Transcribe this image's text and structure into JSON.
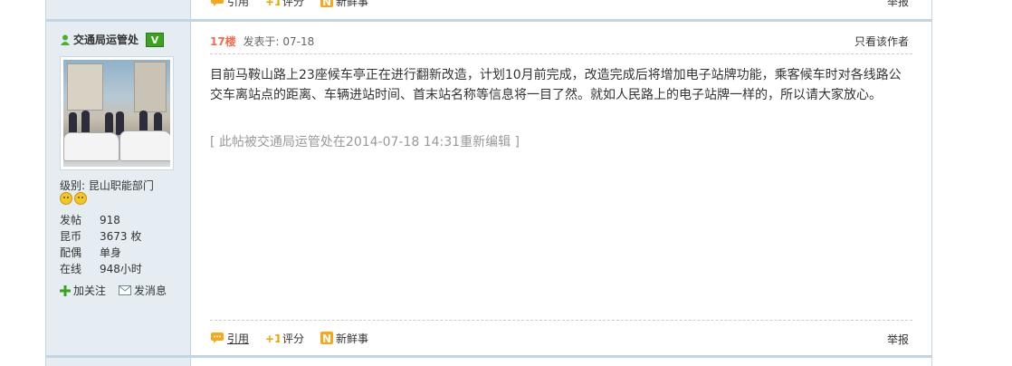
{
  "prev_post": {
    "quote_label": "引用",
    "rate_label": "评分",
    "news_label": "新鲜事",
    "report_label": "举报"
  },
  "author": {
    "name": "交通局运管处",
    "verified_badge": "V",
    "level_text": "级别: 昆山职能部门",
    "stats": [
      {
        "label": "发帖",
        "value": "918"
      },
      {
        "label": "昆币",
        "value": "3673 枚"
      },
      {
        "label": "配偶",
        "value": "单身"
      },
      {
        "label": "在线",
        "value": "948小时"
      }
    ],
    "follow_label": "加关注",
    "message_label": "发消息"
  },
  "post": {
    "floor": "17楼",
    "posted_at": "发表于: 07-18",
    "only_author_label": "只看该作者",
    "body": "目前马鞍山路上23座候车亭正在进行翻新改造，计划10月前完成，改造完成后将增加电子站牌功能，乘客候车时对各线路公交车离站点的距离、车辆进站时间、首末站名称等信息将一目了然。就如人民路上的电子站牌一样的，所以请大家放心。",
    "edit_note": "[ 此帖被交通局运管处在2014-07-18 14:31重新编辑 ]",
    "quote_label": "引用",
    "rate_label": "评分",
    "news_label": "新鲜事",
    "report_label": "举报"
  },
  "colors": {
    "border": "#c2d5e3",
    "sidebar_bg": "#e5edf2",
    "floor_accent": "#f26c4f",
    "verified_green": "#3ba31d"
  }
}
